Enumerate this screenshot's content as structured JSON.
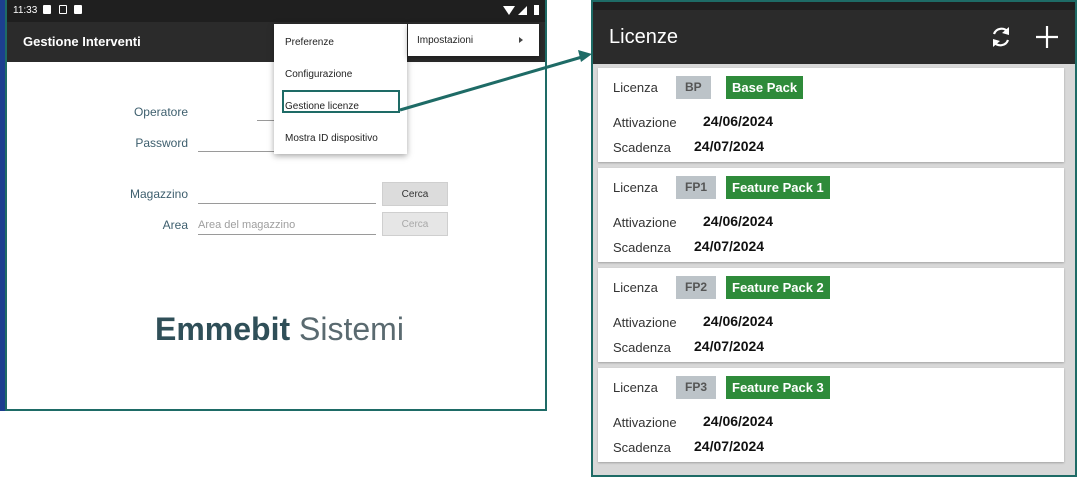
{
  "left_screen": {
    "status_bar": {
      "time": "11:33"
    },
    "app_title": "Gestione Interventi",
    "menu": {
      "items": [
        "Preferenze",
        "Configurazione",
        "Gestione licenze",
        "Mostra ID dispositivo"
      ],
      "submenu_label": "Impostazioni",
      "highlighted_item": "Gestione licenze"
    },
    "form": {
      "operatore_label": "Operatore",
      "password_label": "Password",
      "magazzino_label": "Magazzino",
      "area_label": "Area",
      "area_placeholder": "Area del magazzino",
      "cerca_button_1": "Cerca",
      "cerca_button_2": "Cerca"
    },
    "brand": {
      "bold": "Emmebit",
      "light": "Sistemi"
    }
  },
  "right_screen": {
    "title": "Licenze",
    "icons": [
      "refresh-icon",
      "add-icon"
    ],
    "labels": {
      "licenza": "Licenza",
      "attivazione": "Attivazione",
      "scadenza": "Scadenza"
    },
    "licenses": [
      {
        "code": "BP",
        "name": "Base Pack",
        "activation": "24/06/2024",
        "expiry": "24/07/2024"
      },
      {
        "code": "FP1",
        "name": "Feature Pack 1",
        "activation": "24/06/2024",
        "expiry": "24/07/2024"
      },
      {
        "code": "FP2",
        "name": "Feature Pack 2",
        "activation": "24/06/2024",
        "expiry": "24/07/2024"
      },
      {
        "code": "FP3",
        "name": "Feature Pack 3",
        "activation": "24/06/2024",
        "expiry": "24/07/2024"
      }
    ]
  },
  "colors": {
    "accent": "#1e6b66",
    "appbar": "#2b2b2b",
    "badge_green": "#2e8b3a",
    "badge_gray": "#bcc3c8"
  }
}
